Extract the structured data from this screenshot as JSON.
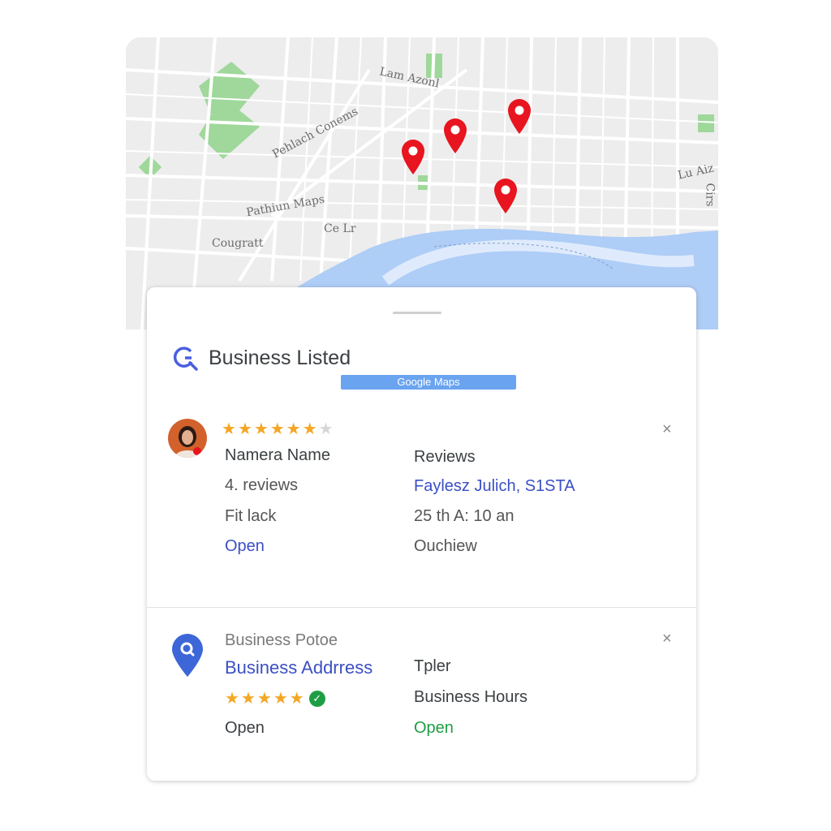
{
  "map": {
    "labels": {
      "label1": "Lam Azonl",
      "label2": "Pehlach Conems",
      "label3": "Pathiun Maps",
      "label4": "Cougratt",
      "label5": "Ce Lr",
      "label6": "Lu Aiz",
      "label7": "Cirs"
    },
    "pin_count": 4,
    "colors": {
      "pin": "#e8141f",
      "water": "#aecdf7",
      "park": "#8fd48a",
      "road": "#ffffff",
      "land": "#ededed"
    }
  },
  "sheet": {
    "title": "Business Listed",
    "badge": "Google Maps",
    "icon": "google-search-icon"
  },
  "listing1": {
    "rating_stars": 6,
    "rating_total": 7,
    "name": "Namera Name",
    "reviews_count": "4. reviews",
    "category": "Fit lack",
    "status": "Open",
    "reviews_header": "Reviews",
    "reviewer": "Faylesz Julich, S1STA",
    "hours": "25 th A: 10 an",
    "overview": "Ouchiew",
    "close": "×"
  },
  "listing2": {
    "phone_label": "Business Potoe",
    "address": "Business Addrress",
    "rating_stars": 5,
    "verified_icon": "check-icon",
    "status": "Open",
    "type": "Tpler",
    "hours_label": "Business Hours",
    "hours_status": "Open",
    "close": "×"
  }
}
